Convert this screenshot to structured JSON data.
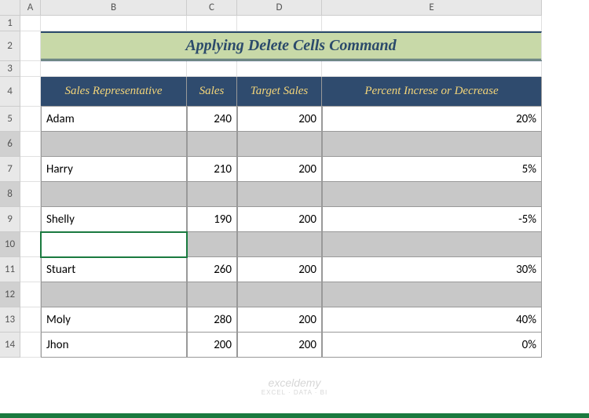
{
  "columns": [
    "",
    "A",
    "B",
    "C",
    "D",
    "E"
  ],
  "rows": [
    "1",
    "2",
    "3",
    "4",
    "5",
    "6",
    "7",
    "8",
    "9",
    "10",
    "11",
    "12",
    "13",
    "14"
  ],
  "title": "Applying Delete Cells Command",
  "headers": {
    "rep": "Sales Representative",
    "sales": "Sales",
    "target": "Target Sales",
    "percent": "Percent Increse or Decrease"
  },
  "chart_data": {
    "type": "table",
    "title": "Applying Delete Cells Command",
    "columns": [
      "Sales Representative",
      "Sales",
      "Target Sales",
      "Percent Increse or Decrease"
    ],
    "rows": [
      {
        "rep": "Adam",
        "sales": 240,
        "target": 200,
        "percent": "20%"
      },
      {
        "rep": "Harry",
        "sales": 210,
        "target": 200,
        "percent": "5%"
      },
      {
        "rep": "Shelly",
        "sales": 190,
        "target": 200,
        "percent": "-5%"
      },
      {
        "rep": "Stuart",
        "sales": 260,
        "target": 200,
        "percent": "30%"
      },
      {
        "rep": "Moly",
        "sales": 280,
        "target": 200,
        "percent": "40%"
      },
      {
        "rep": "Jhon",
        "sales": 200,
        "target": 200,
        "percent": "0%"
      }
    ]
  },
  "watermark": {
    "line1": "exceldemy",
    "line2": "EXCEL · DATA · BI"
  }
}
